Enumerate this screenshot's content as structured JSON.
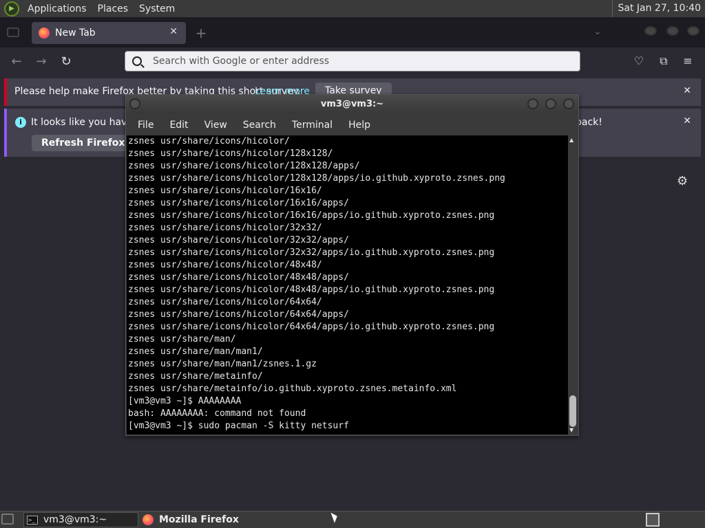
{
  "top_panel": {
    "menus": [
      "Applications",
      "Places",
      "System"
    ],
    "clock": "Sat Jan 27, 10:40"
  },
  "firefox": {
    "tab_title": "New Tab",
    "url_placeholder": "Search with Google or enter address",
    "survey_notice": "Please help make Firefox better by taking this short survey.",
    "survey_link": "Learn more",
    "survey_button": "Take survey",
    "refresh_notice_start": "It looks like you haven't",
    "refresh_notice_end": "back!",
    "refresh_button": "Refresh Firefox…"
  },
  "terminal": {
    "title": "vm3@vm3:~",
    "menu": [
      "File",
      "Edit",
      "View",
      "Search",
      "Terminal",
      "Help"
    ],
    "lines": [
      "zsnes usr/share/icons/hicolor/",
      "zsnes usr/share/icons/hicolor/128x128/",
      "zsnes usr/share/icons/hicolor/128x128/apps/",
      "zsnes usr/share/icons/hicolor/128x128/apps/io.github.xyproto.zsnes.png",
      "zsnes usr/share/icons/hicolor/16x16/",
      "zsnes usr/share/icons/hicolor/16x16/apps/",
      "zsnes usr/share/icons/hicolor/16x16/apps/io.github.xyproto.zsnes.png",
      "zsnes usr/share/icons/hicolor/32x32/",
      "zsnes usr/share/icons/hicolor/32x32/apps/",
      "zsnes usr/share/icons/hicolor/32x32/apps/io.github.xyproto.zsnes.png",
      "zsnes usr/share/icons/hicolor/48x48/",
      "zsnes usr/share/icons/hicolor/48x48/apps/",
      "zsnes usr/share/icons/hicolor/48x48/apps/io.github.xyproto.zsnes.png",
      "zsnes usr/share/icons/hicolor/64x64/",
      "zsnes usr/share/icons/hicolor/64x64/apps/",
      "zsnes usr/share/icons/hicolor/64x64/apps/io.github.xyproto.zsnes.png",
      "zsnes usr/share/man/",
      "zsnes usr/share/man/man1/",
      "zsnes usr/share/man/man1/zsnes.1.gz",
      "zsnes usr/share/metainfo/",
      "zsnes usr/share/metainfo/io.github.xyproto.zsnes.metainfo.xml",
      "[vm3@vm3 ~]$ AAAAAAAA",
      "bash: AAAAAAAA: command not found",
      "[vm3@vm3 ~]$ sudo pacman -S kitty netsurf"
    ]
  },
  "taskbar": {
    "items": [
      "vm3@vm3:~",
      "Mozilla Firefox"
    ]
  }
}
